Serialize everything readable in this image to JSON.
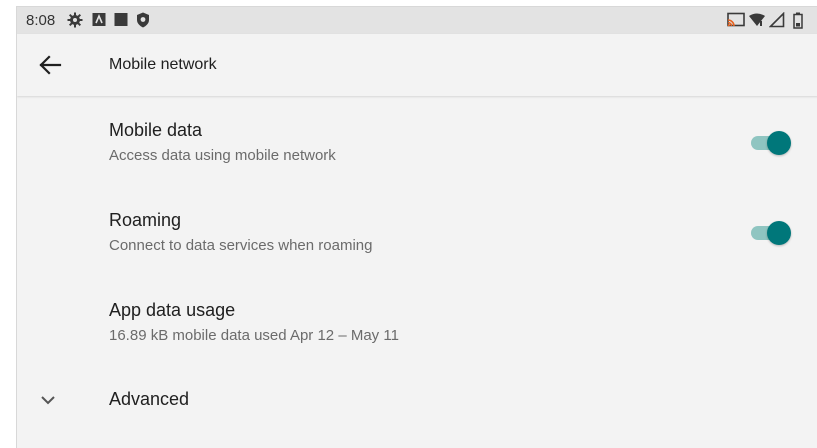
{
  "status_bar": {
    "time": "8:08",
    "icons": [
      "gear-icon",
      "a-icon",
      "square-icon",
      "shield-icon",
      "cast-icon",
      "wifi-icon",
      "signal-icon",
      "battery-icon"
    ]
  },
  "toolbar": {
    "title": "Mobile network",
    "back_icon": "arrow-back-icon"
  },
  "settings": {
    "mobile_data": {
      "title": "Mobile data",
      "summary": "Access data using mobile network",
      "enabled": true
    },
    "roaming": {
      "title": "Roaming",
      "summary": "Connect to data services when roaming",
      "enabled": true
    },
    "app_data_usage": {
      "title": "App data usage",
      "summary": "16.89 kB mobile data used Apr 12 – May 11"
    },
    "advanced": {
      "title": "Advanced",
      "icon": "chevron-down-icon"
    }
  },
  "colors": {
    "accent": "#00777a",
    "track": "#8fc5c1",
    "background": "#f3f3f3"
  }
}
